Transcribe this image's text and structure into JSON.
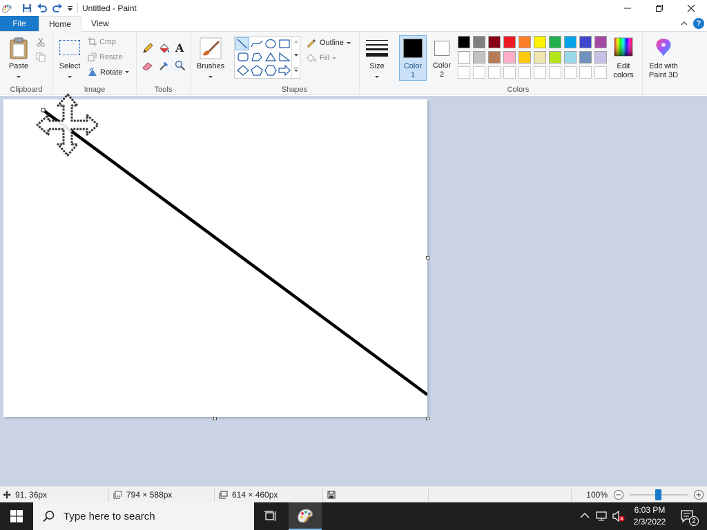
{
  "window": {
    "title": "Untitled - Paint"
  },
  "tabs": {
    "file": "File",
    "home": "Home",
    "view": "View"
  },
  "ribbon": {
    "clipboard": {
      "paste": "Paste",
      "label": "Clipboard"
    },
    "image": {
      "select": "Select",
      "crop": "Crop",
      "resize": "Resize",
      "rotate": "Rotate",
      "label": "Image"
    },
    "tools": {
      "label": "Tools"
    },
    "brushes": {
      "label": "Brushes"
    },
    "shapes": {
      "outline": "Outline",
      "fill": "Fill",
      "label": "Shapes"
    },
    "size": {
      "label": "Size"
    },
    "colors": {
      "color1": "Color",
      "color1_num": "1",
      "color2": "Color",
      "color2_num": "2",
      "color1_value": "#000000",
      "color2_value": "#ffffff",
      "edit_colors": "Edit",
      "edit_colors_2": "colors",
      "label": "Colors",
      "palette_row1": [
        "#000000",
        "#7f7f7f",
        "#880015",
        "#ed1c24",
        "#ff7f27",
        "#fff200",
        "#22b14c",
        "#00a2e8",
        "#3f48cc",
        "#a349a4"
      ],
      "palette_row2": [
        "#ffffff",
        "#c3c3c3",
        "#b97a57",
        "#ffaec9",
        "#ffc90e",
        "#efe4b0",
        "#b5e61d",
        "#99d9ea",
        "#7092be",
        "#c8bfe7"
      ]
    },
    "paint3d": {
      "line1": "Edit with",
      "line2": "Paint 3D"
    }
  },
  "canvas": {
    "line_color": "#000000"
  },
  "statusbar": {
    "cursor_pos": "91, 36px",
    "selection_size": "794 × 588px",
    "image_size": "614 × 460px",
    "zoom": "100%"
  },
  "taskbar": {
    "search_placeholder": "Type here to search",
    "time": "6:03 PM",
    "date": "2/3/2022",
    "notifications": "2"
  }
}
